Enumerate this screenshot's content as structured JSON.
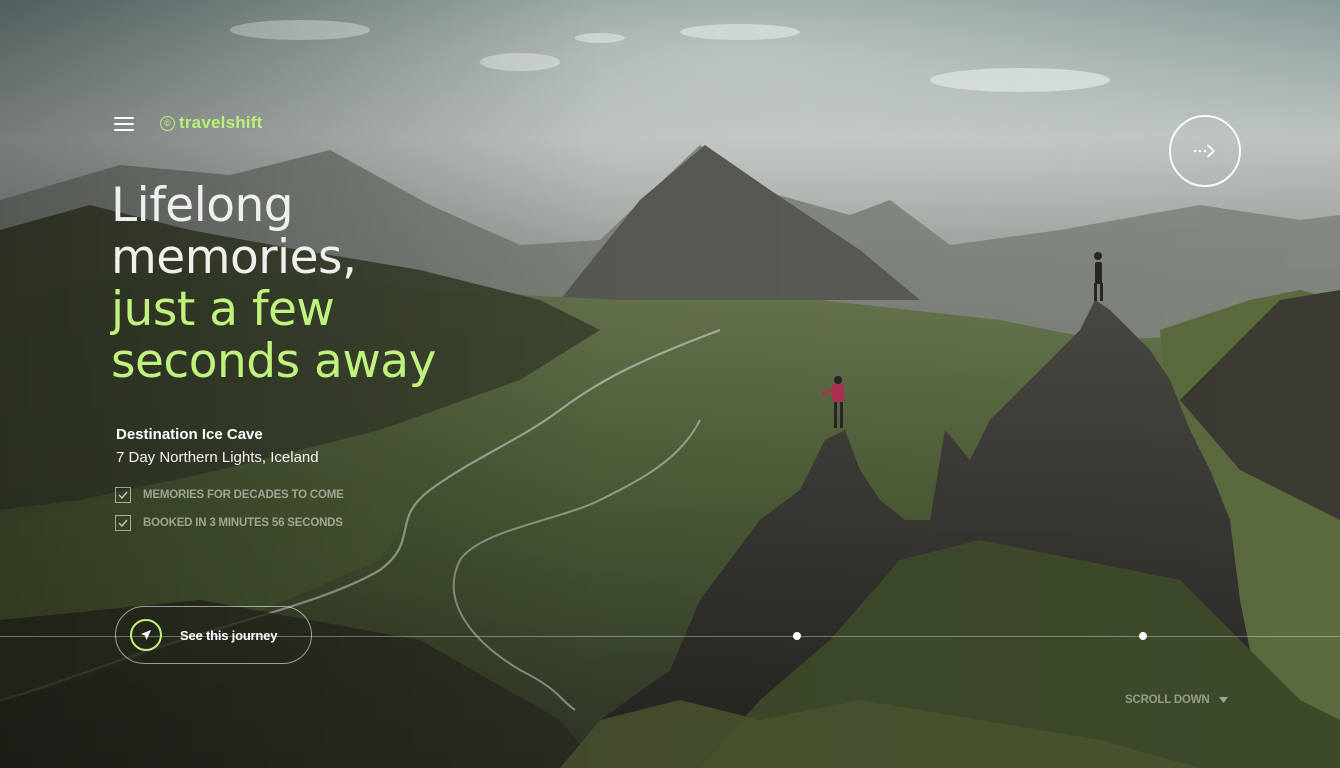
{
  "brand": {
    "logo_text": "travelshift",
    "logo_mark": "©",
    "accent_color": "#c0f27d"
  },
  "header": {
    "menu_icon": "hamburger-icon",
    "next_icon": "arrow-right-icon"
  },
  "hero": {
    "line1": "Lifelong",
    "line2": "memories,",
    "line3": "just a few",
    "line4": "seconds away"
  },
  "destination": {
    "title": "Destination Ice Cave",
    "subtitle": "7 Day Northern Lights, Iceland",
    "features": [
      {
        "label": "MEMORIES FOR DECADES TO COME",
        "checked": true
      },
      {
        "label": "BOOKED IN 3 MINUTES 56 SECONDS",
        "checked": true
      }
    ]
  },
  "cta": {
    "label": "See this journey",
    "icon": "navigation-arrow-icon"
  },
  "scroll": {
    "label": "SCROLL DOWN",
    "icon": "triangle-down-icon"
  }
}
